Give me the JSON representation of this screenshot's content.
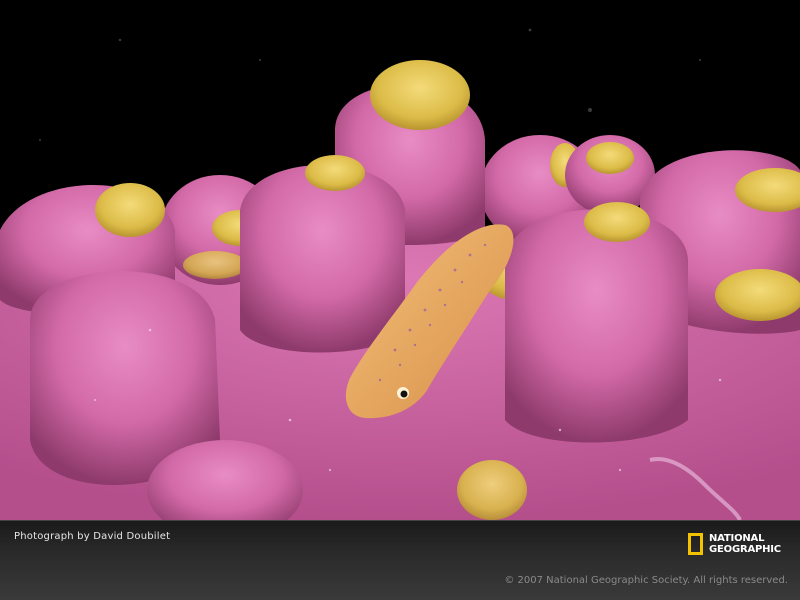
{
  "photo": {
    "subject": "clingfish on pink sponge"
  },
  "caption": {
    "credit": "Photograph by David Doubilet",
    "copyright": "© 2007 National Geographic Society. All rights reserved."
  },
  "logo": {
    "line1": "NATIONAL",
    "line2": "GEOGRAPHIC"
  },
  "colors": {
    "sponge": "#d36aa8",
    "sponge_dark": "#a8467f",
    "tip": "#e0c24e",
    "fish": "#e7a75a",
    "background": "#000000",
    "logo_yellow": "#f4c300"
  }
}
